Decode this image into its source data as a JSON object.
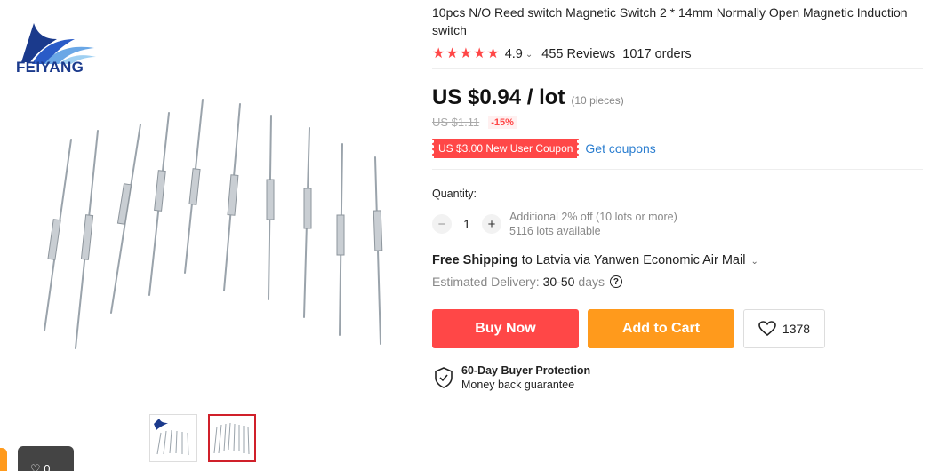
{
  "brand": {
    "logo_text": "FEIYANG"
  },
  "gallery": {
    "thumbnails": [
      {
        "label": "thumbnail-1"
      },
      {
        "label": "thumbnail-2"
      }
    ],
    "wishlist_pill_count": "0"
  },
  "product": {
    "title": "10pcs N/O Reed switch Magnetic Switch 2 * 14mm Normally Open Magnetic Induction switch",
    "rating": "4.9",
    "stars": 5,
    "reviews": "455 Reviews",
    "orders": "1017 orders"
  },
  "price": {
    "current": "US $0.94 / lot",
    "unit_note": "(10 pieces)",
    "original": "US $1.11",
    "discount": "-15%"
  },
  "coupon": {
    "label": "US $3.00 New User Coupon",
    "link": "Get coupons"
  },
  "quantity": {
    "label": "Quantity:",
    "value": "1",
    "minus": "−",
    "plus": "+",
    "note_1": "Additional 2% off (10 lots or more)",
    "note_2": "5116 lots available"
  },
  "shipping": {
    "bold": "Free Shipping",
    "rest": "to Latvia via Yanwen Economic Air Mail",
    "estimated_label": "Estimated Delivery:",
    "estimated_value": "30-50",
    "estimated_unit": "days",
    "help_glyph": "?"
  },
  "actions": {
    "buy_now": "Buy Now",
    "add_to_cart": "Add to Cart",
    "wishlist_count": "1378"
  },
  "protection": {
    "title": "60-Day Buyer Protection",
    "subtitle": "Money back guarantee"
  },
  "colors": {
    "accent_red": "#ff4747",
    "accent_orange": "#ff9a1c",
    "link_blue": "#2b7ed0",
    "brand_blue": "#1b3a8c"
  }
}
